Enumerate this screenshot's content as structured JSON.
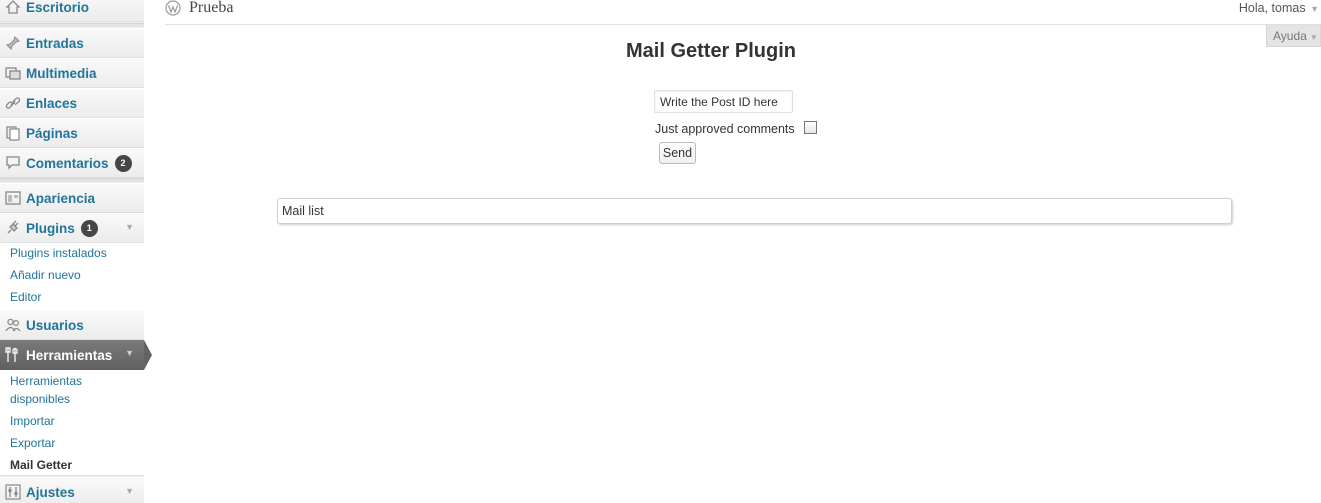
{
  "header": {
    "site_name": "Prueba",
    "greeting": "Hola, tomas",
    "help_tab": "Ayuda"
  },
  "sidebar": {
    "items": [
      {
        "label": "Escritorio",
        "icon": "dashboard-icon"
      },
      {
        "label": "Entradas",
        "icon": "pin-icon"
      },
      {
        "label": "Multimedia",
        "icon": "media-icon"
      },
      {
        "label": "Enlaces",
        "icon": "link-icon"
      },
      {
        "label": "Páginas",
        "icon": "pages-icon"
      },
      {
        "label": "Comentarios",
        "icon": "comment-icon",
        "badge": "2"
      },
      {
        "label": "Apariencia",
        "icon": "appearance-icon"
      },
      {
        "label": "Plugins",
        "icon": "plugin-icon",
        "badge": "1"
      },
      {
        "label": "Usuarios",
        "icon": "users-icon"
      },
      {
        "label": "Herramientas",
        "icon": "tools-icon"
      },
      {
        "label": "Ajustes",
        "icon": "settings-icon"
      }
    ],
    "plugins_submenu": [
      "Plugins instalados",
      "Añadir nuevo",
      "Editor"
    ],
    "tools_submenu": [
      "Herramientas",
      "disponibles",
      "Importar",
      "Exportar",
      "Mail Getter"
    ]
  },
  "main": {
    "title": "Mail Getter Plugin",
    "post_id_value": "Write the Post ID here",
    "approved_label": "Just approved comments",
    "approved_checked": false,
    "send_label": "Send",
    "mail_list_value": "Mail list"
  },
  "colors": {
    "link": "#21759b",
    "current_menu_bg": "#6b6b6b",
    "badge_bg": "#464646"
  }
}
